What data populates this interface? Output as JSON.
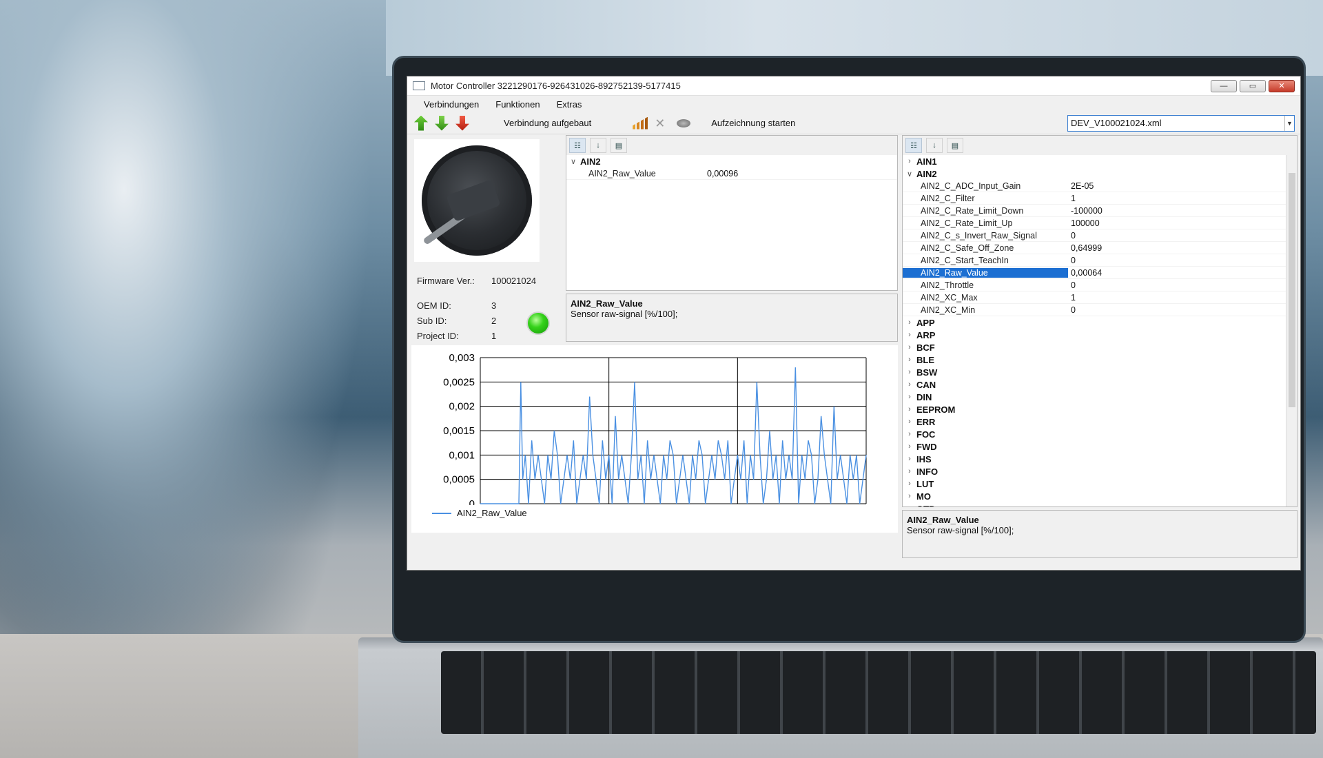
{
  "window": {
    "title": "Motor Controller 3221290176-926431026-892752139-5177415",
    "controls": {
      "minimize": "—",
      "maximize": "▭",
      "close": "✕"
    }
  },
  "menu": {
    "items": [
      "Verbindungen",
      "Funktionen",
      "Extras"
    ]
  },
  "toolbar": {
    "status": "Verbindung aufgebaut",
    "record": "Aufzeichnung starten",
    "file_combo": "DEV_V100021024.xml"
  },
  "device": {
    "firmware_label": "Firmware Ver.:",
    "firmware_value": "100021024",
    "oem_label": "OEM ID:",
    "oem_value": "3",
    "sub_label": "Sub ID:",
    "sub_value": "2",
    "project_label": "Project ID:",
    "project_value": "1",
    "led_color": "#35d21a"
  },
  "middle_grid": {
    "category": "AIN2",
    "properties": [
      {
        "name": "AIN2_Raw_Value",
        "value": "0,00096"
      }
    ],
    "description": {
      "title": "AIN2_Raw_Value",
      "text": "Sensor raw-signal [%/100];"
    }
  },
  "right_grid": {
    "categories_before": [
      "AIN1"
    ],
    "expanded_category": "AIN2",
    "properties": [
      {
        "name": "AIN2_C_ADC_Input_Gain",
        "value": "2E-05"
      },
      {
        "name": "AIN2_C_Filter",
        "value": "1"
      },
      {
        "name": "AIN2_C_Rate_Limit_Down",
        "value": "-100000"
      },
      {
        "name": "AIN2_C_Rate_Limit_Up",
        "value": "100000"
      },
      {
        "name": "AIN2_C_s_Invert_Raw_Signal",
        "value": "0"
      },
      {
        "name": "AIN2_C_Safe_Off_Zone",
        "value": "0,64999"
      },
      {
        "name": "AIN2_C_Start_TeachIn",
        "value": "0"
      },
      {
        "name": "AIN2_Raw_Value",
        "value": "0,00064",
        "selected": true
      },
      {
        "name": "AIN2_Throttle",
        "value": "0"
      },
      {
        "name": "AIN2_XC_Max",
        "value": "1"
      },
      {
        "name": "AIN2_XC_Min",
        "value": "0"
      }
    ],
    "categories_after": [
      "APP",
      "ARP",
      "BCF",
      "BLE",
      "BSW",
      "CAN",
      "DIN",
      "EEPROM",
      "ERR",
      "FOC",
      "FWD",
      "IHS",
      "INFO",
      "LUT",
      "MO",
      "OTP"
    ],
    "description": {
      "title": "AIN2_Raw_Value",
      "text": "Sensor raw-signal [%/100];"
    }
  },
  "chart_data": {
    "type": "line",
    "series": [
      {
        "name": "AIN2_Raw_Value",
        "color": "#4a90e2",
        "x": [
          0,
          60,
          63,
          66,
          70,
          75,
          80,
          85,
          90,
          95,
          100,
          105,
          110,
          115,
          120,
          125,
          130,
          135,
          140,
          145,
          150,
          155,
          160,
          165,
          170,
          175,
          180,
          185,
          190,
          195,
          200,
          205,
          210,
          215,
          220,
          225,
          230,
          235,
          240,
          245,
          250,
          255,
          260,
          265,
          270,
          275,
          280,
          285,
          290,
          295,
          300,
          305,
          310,
          315,
          320,
          325,
          330,
          335,
          340,
          345,
          350,
          355,
          360,
          365,
          370,
          375,
          380,
          385,
          390,
          395,
          400,
          405,
          410,
          415,
          420,
          425,
          430,
          435,
          440,
          445,
          450,
          455,
          460,
          465,
          470,
          475,
          480,
          485,
          490,
          495,
          500,
          505,
          510,
          515,
          520,
          525,
          530,
          535,
          540,
          545,
          550,
          555,
          560,
          565,
          570,
          575,
          580,
          585,
          590,
          595,
          600
        ],
        "values": [
          0,
          0,
          0.0025,
          0.0005,
          0.001,
          0,
          0.0013,
          0.0005,
          0.001,
          0.0005,
          0,
          0.001,
          0.0005,
          0.0015,
          0.001,
          0,
          0.0005,
          0.001,
          0.0005,
          0.0013,
          0,
          0.0005,
          0.001,
          0.0005,
          0.0022,
          0.001,
          0.0005,
          0,
          0.0013,
          0.0005,
          0.001,
          0,
          0.0018,
          0.0005,
          0.001,
          0.0005,
          0,
          0.001,
          0.0025,
          0.0005,
          0.001,
          0,
          0.0013,
          0.0005,
          0.001,
          0.0005,
          0,
          0.001,
          0.0005,
          0.0013,
          0.001,
          0,
          0.0005,
          0.001,
          0.0005,
          0,
          0.001,
          0.0005,
          0.0013,
          0.001,
          0,
          0.0005,
          0.001,
          0.0005,
          0.0013,
          0.001,
          0.0005,
          0.0013,
          0,
          0.0005,
          0.001,
          0.0005,
          0.0013,
          0,
          0.001,
          0.0005,
          0.0025,
          0.001,
          0,
          0.0005,
          0.0015,
          0.0005,
          0.001,
          0,
          0.0013,
          0.0005,
          0.001,
          0.0005,
          0.0028,
          0,
          0.001,
          0.0005,
          0.0013,
          0.001,
          0,
          0.0005,
          0.0018,
          0.001,
          0.0005,
          0,
          0.002,
          0.0005,
          0.001,
          0.0005,
          0,
          0.001,
          0.0005,
          0.001,
          0,
          0.0005,
          0.001
        ]
      }
    ],
    "xlim": [
      0,
      600
    ],
    "ylim": [
      0,
      0.003
    ],
    "xticks": [
      "0",
      "200",
      "400",
      "600"
    ],
    "yticks": [
      "0",
      "0,0005",
      "0,001",
      "0,0015",
      "0,002",
      "0,0025",
      "0,003"
    ],
    "grid": true,
    "legend": "bottom-left"
  }
}
